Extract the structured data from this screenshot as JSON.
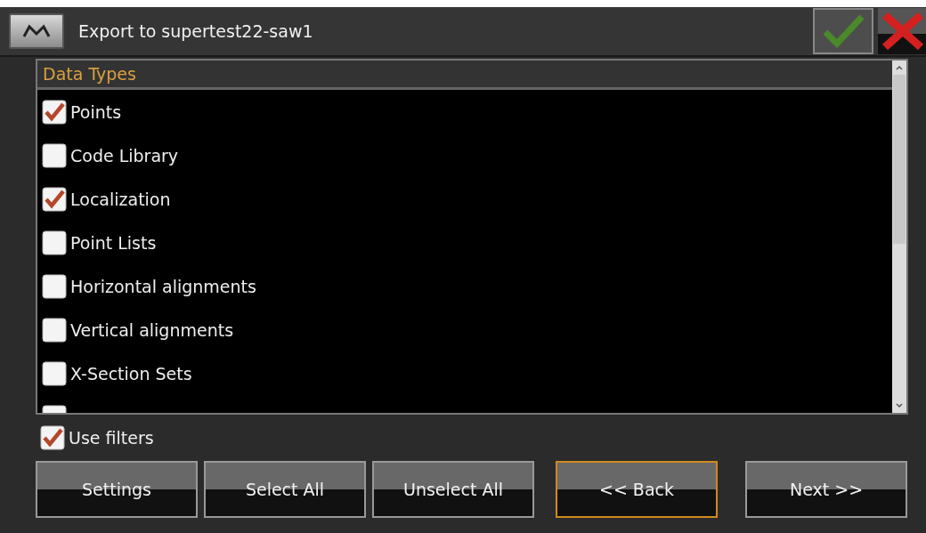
{
  "window": {
    "title": "Export to supertest22-saw1"
  },
  "list": {
    "header": "Data Types",
    "items": [
      {
        "label": "Points",
        "checked": true
      },
      {
        "label": "Code Library",
        "checked": false
      },
      {
        "label": "Localization",
        "checked": true
      },
      {
        "label": "Point Lists",
        "checked": false
      },
      {
        "label": "Horizontal alignments",
        "checked": false
      },
      {
        "label": "Vertical alignments",
        "checked": false
      },
      {
        "label": "X-Section Sets",
        "checked": false
      },
      {
        "checked": false
      }
    ]
  },
  "use_filters": {
    "label": "Use filters",
    "checked": true
  },
  "buttons": [
    {
      "label": "Settings",
      "focused": false
    },
    {
      "label": "Select All",
      "focused": false
    },
    {
      "label": "Unselect All",
      "focused": false
    },
    {
      "label": "<< Back",
      "focused": true
    },
    {
      "label": "Next >>",
      "focused": false
    }
  ]
}
